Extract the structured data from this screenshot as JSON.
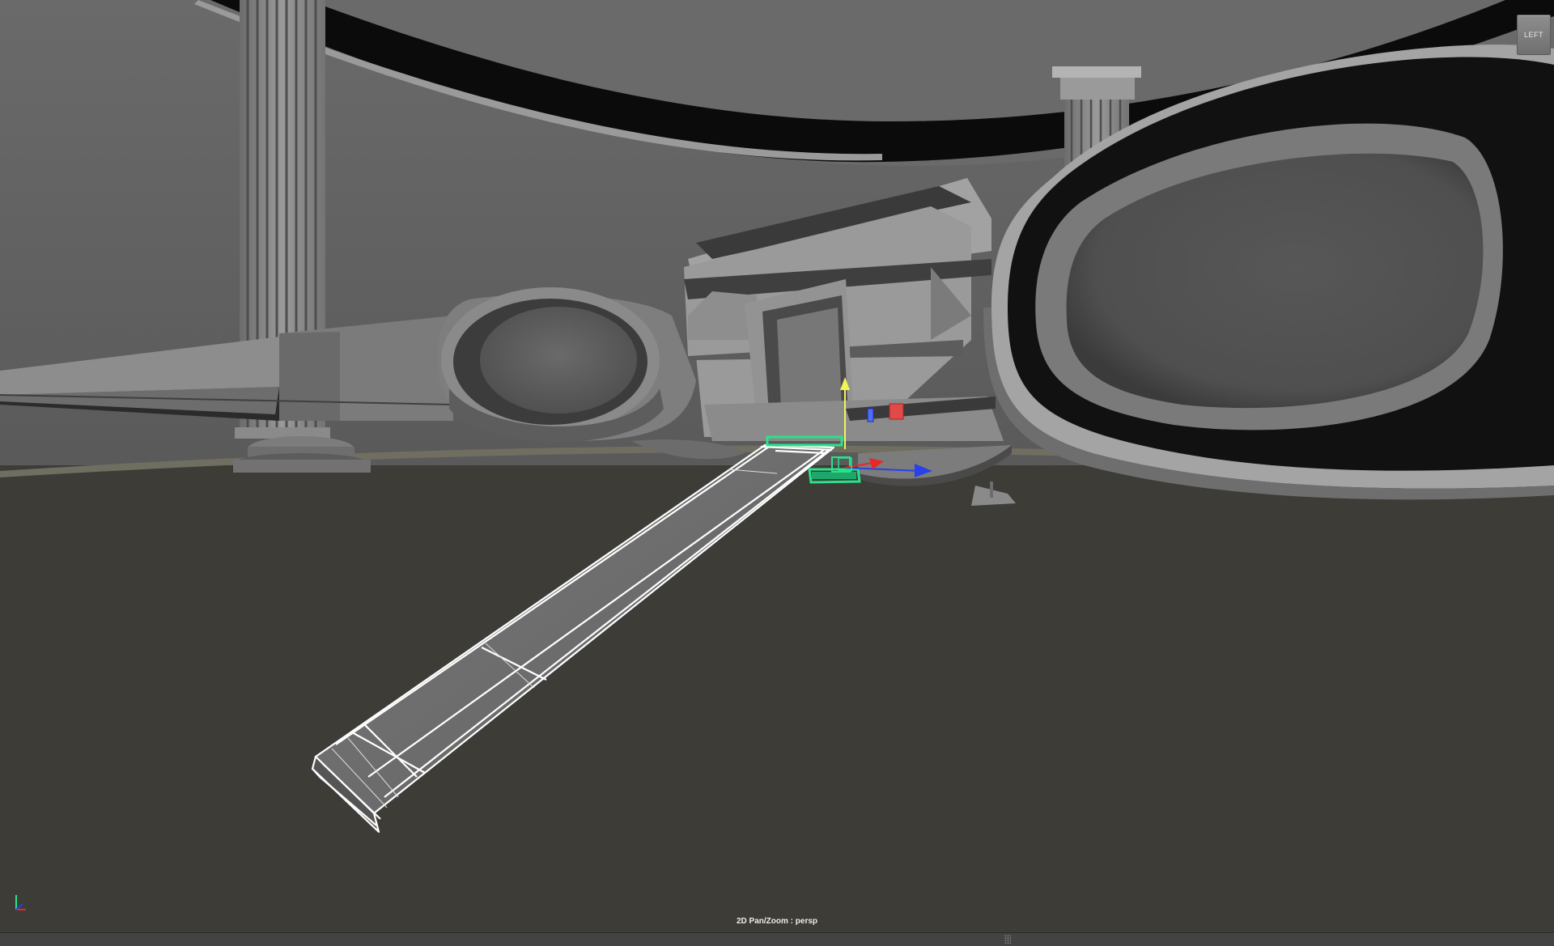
{
  "viewport": {
    "camera": "persp",
    "status_text": "2D Pan/Zoom : persp",
    "view_cube_label": "LEFT"
  },
  "colors": {
    "background_wall": "#5e5e5e",
    "ground": "#3d3c37",
    "horizon_line": "#6f6e60",
    "selection_highlight": "#27e38b",
    "manipulator_y": "#f2f25a",
    "manipulator_x": "#e82727",
    "manipulator_z": "#2742e8",
    "wireframe": "#ffffff"
  },
  "icons": {
    "view_cube": "view-cube-icon",
    "axis": "axis-indicator-icon",
    "move_manipulator": "move-manipulator-icon",
    "pane_splitter": "pane-splitter-handle-icon"
  }
}
